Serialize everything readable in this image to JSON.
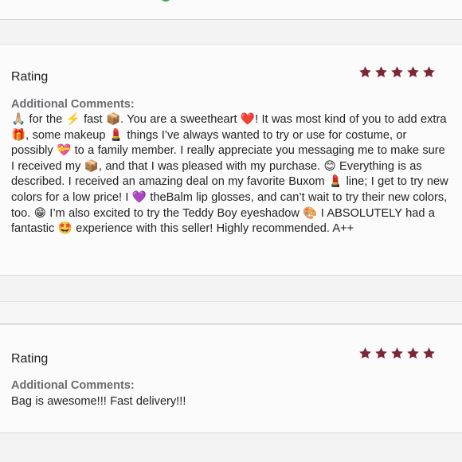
{
  "colors": {
    "star": "#7b2535",
    "heading_gray": "#6b6b6f",
    "status_dot": "#3cae4f"
  },
  "reviews": [
    {
      "rating_label": "Rating",
      "stars": 5,
      "comments_label": "Additional Comments:",
      "comment": "🙏🏼 for the ⚡️ fast 📦. You are a sweetheart ❤️! It was most kind of you to add extra 🎁, some makeup 💄 things I’ve always wanted to try or use for costume, or possibly 💝 to a family member. I really appreciate you messaging me to make sure I received my 📦, and that I was pleased with my purchase. 😊 Everything is as described. I received an amazing deal on my favorite Buxom 💄 line; I get to try new colors for a low price! I 💜 theBalm lip glosses, and can’t wait to try their new colors, too. 😁 I’m also excited to try the Teddy Boy eyeshadow 🎨 I ABSOLUTELY had a fantastic 🤩 experience with this seller! Highly recommended. A++"
    },
    {
      "rating_label": "Rating",
      "stars": 5,
      "comments_label": "Additional Comments:",
      "comment": "Bag is awesome!!! Fast delivery!!!"
    }
  ]
}
